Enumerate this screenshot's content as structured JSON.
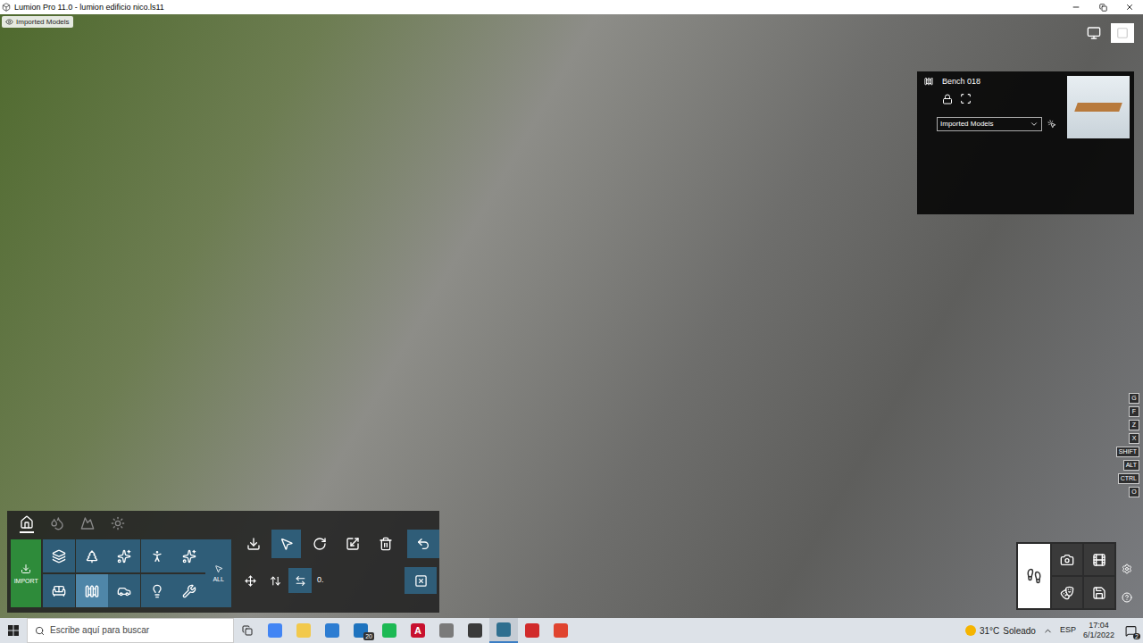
{
  "window": {
    "title": "Lumion Pro 11.0 - lumion edificio nico.ls11"
  },
  "view_badge": {
    "label": "Imported Models"
  },
  "view_modes": [
    {
      "selected": false
    },
    {
      "selected": true
    }
  ],
  "properties": {
    "name": "Bench 018",
    "locked": false,
    "layer": "Imported Models"
  },
  "toolbar": {
    "tabs": [
      {
        "selected": true
      },
      {
        "selected": false
      },
      {
        "selected": false
      },
      {
        "selected": false
      }
    ],
    "import_label": "IMPORT",
    "categories": [
      {
        "selected": false
      },
      {
        "selected": false
      },
      {
        "selected": false
      },
      {
        "selected": false
      },
      {
        "selected": false
      },
      {
        "selected": false
      },
      {
        "selected": true
      },
      {
        "selected": false
      },
      {
        "selected": false
      },
      {
        "selected": false
      }
    ],
    "all_label": "ALL",
    "tools_top": [
      {
        "selected": false
      },
      {
        "selected": true
      },
      {
        "selected": false
      },
      {
        "selected": false
      },
      {
        "selected": false
      },
      {
        "selected": false
      }
    ],
    "tools_bottom": [
      {
        "selected": false
      },
      {
        "selected": false
      },
      {
        "selected": true
      }
    ],
    "value": "0."
  },
  "shortcuts": [
    "G",
    "F",
    "Z",
    "X",
    "SHIFT",
    "ALT",
    "CTRL",
    "O"
  ],
  "modes": [
    {
      "selected": true
    },
    {
      "selected": false
    },
    {
      "selected": false
    },
    {
      "selected": false
    },
    {
      "selected": false
    }
  ],
  "taskbar": {
    "search_placeholder": "Escribe aquí para buscar",
    "apps": [
      {
        "label": "",
        "badge": "",
        "color": "#4285f4",
        "active": false
      },
      {
        "label": "",
        "badge": "",
        "color": "#f2c94c",
        "active": false
      },
      {
        "label": "",
        "badge": "",
        "color": "#2d7dd2",
        "active": false
      },
      {
        "label": "",
        "badge": "20",
        "color": "#1e73be",
        "active": false
      },
      {
        "label": "",
        "badge": "",
        "color": "#1db954",
        "active": false
      },
      {
        "label": "A",
        "badge": "",
        "color": "#c8102e",
        "active": false
      },
      {
        "label": "",
        "badge": "",
        "color": "#7a7a7a",
        "active": false
      },
      {
        "label": "",
        "badge": "",
        "color": "#3a3a3a",
        "active": false
      },
      {
        "label": "",
        "badge": "",
        "color": "#2f6f8f",
        "active": true
      },
      {
        "label": "",
        "badge": "",
        "color": "#d12b2b",
        "active": false
      },
      {
        "label": "",
        "badge": "",
        "color": "#e0442f",
        "active": false
      }
    ],
    "weather": {
      "temp": "31°C",
      "condition": "Soleado"
    },
    "language": "ESP",
    "time": "17:04",
    "date": "6/1/2022",
    "notifications": "2"
  }
}
